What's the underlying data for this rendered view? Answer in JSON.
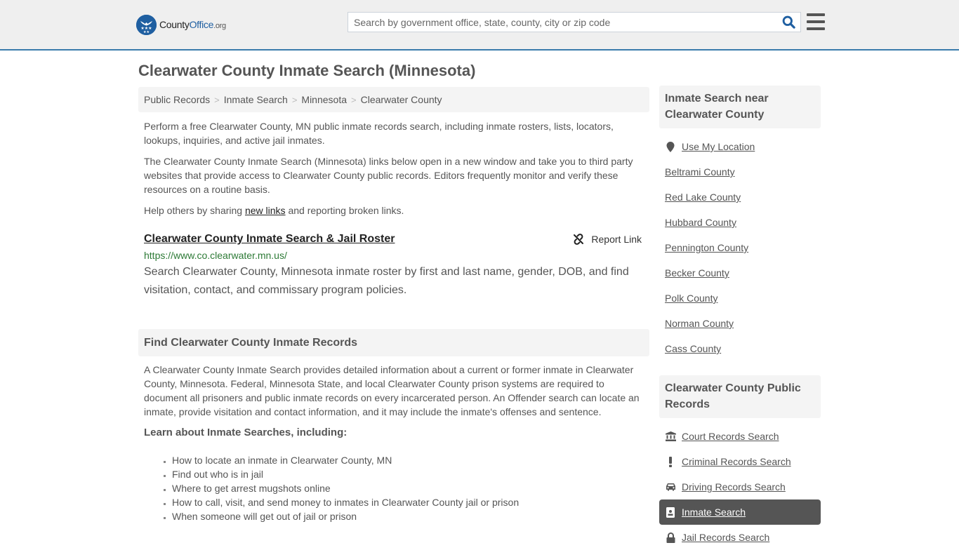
{
  "header": {
    "logo": {
      "name_part1": "County",
      "name_part2": "Office",
      "tld": ".org"
    },
    "search": {
      "placeholder": "Search by government office, state, county, city or zip code",
      "value": ""
    },
    "icons": {
      "search": "search-icon",
      "menu": "hamburger-menu-icon"
    }
  },
  "page": {
    "title": "Clearwater County Inmate Search (Minnesota)"
  },
  "breadcrumb": [
    {
      "label": "Public Records"
    },
    {
      "label": "Inmate Search"
    },
    {
      "label": "Minnesota"
    },
    {
      "label": "Clearwater County"
    }
  ],
  "intro": {
    "p1": "Perform a free Clearwater County, MN public inmate records search, including inmate rosters, lists, locators, lookups, inquiries, and active jail inmates.",
    "p2": "The Clearwater County Inmate Search (Minnesota) links below open in a new window and take you to third party websites that provide access to Clearwater County public records. Editors frequently monitor and verify these resources on a routine basis.",
    "p3_before": "Help others by sharing ",
    "p3_link": "new links",
    "p3_after": " and reporting broken links."
  },
  "links": [
    {
      "title": "Clearwater County Inmate Search & Jail Roster",
      "url": "https://www.co.clearwater.mn.us/",
      "description": "Search Clearwater County, Minnesota inmate roster by first and last name, gender, DOB, and find visitation, contact, and commissary program policies.",
      "report_label": "Report Link"
    }
  ],
  "find_section": {
    "heading": "Find Clearwater County Inmate Records",
    "paragraph": "A Clearwater County Inmate Search provides detailed information about a current or former inmate in Clearwater County, Minnesota. Federal, Minnesota State, and local Clearwater County prison systems are required to document all prisoners and public inmate records on every incarcerated person. An Offender search can locate an inmate, provide visitation and contact information, and it may include the inmate's offenses and sentence.",
    "subheading": "Learn about Inmate Searches, including:",
    "bullets": [
      "How to locate an inmate in Clearwater County, MN",
      "Find out who is in jail",
      "Where to get arrest mugshots online",
      "How to call, visit, and send money to inmates in Clearwater County jail or prison",
      "When someone will get out of jail or prison"
    ]
  },
  "sidebar": {
    "nearby": {
      "heading": "Inmate Search near Clearwater County",
      "use_location": "Use My Location",
      "counties": [
        "Beltrami County",
        "Red Lake County",
        "Hubbard County",
        "Pennington County",
        "Becker County",
        "Polk County",
        "Norman County",
        "Cass County"
      ]
    },
    "public_records": {
      "heading": "Clearwater County Public Records",
      "items": [
        {
          "label": "Court Records Search",
          "icon": "courthouse-icon",
          "active": false
        },
        {
          "label": "Criminal Records Search",
          "icon": "exclamation-icon",
          "active": false
        },
        {
          "label": "Driving Records Search",
          "icon": "car-icon",
          "active": false
        },
        {
          "label": "Inmate Search",
          "icon": "id-badge-icon",
          "active": true
        },
        {
          "label": "Jail Records Search",
          "icon": "lock-icon",
          "active": false
        }
      ]
    }
  },
  "colors": {
    "header_bg": "#efefef",
    "header_border": "#3a7bab",
    "brand_blue": "#1f5fa1",
    "url_green": "#2d7a36",
    "active_item_bg": "#555555",
    "panel_bg": "#f4f4f4"
  }
}
